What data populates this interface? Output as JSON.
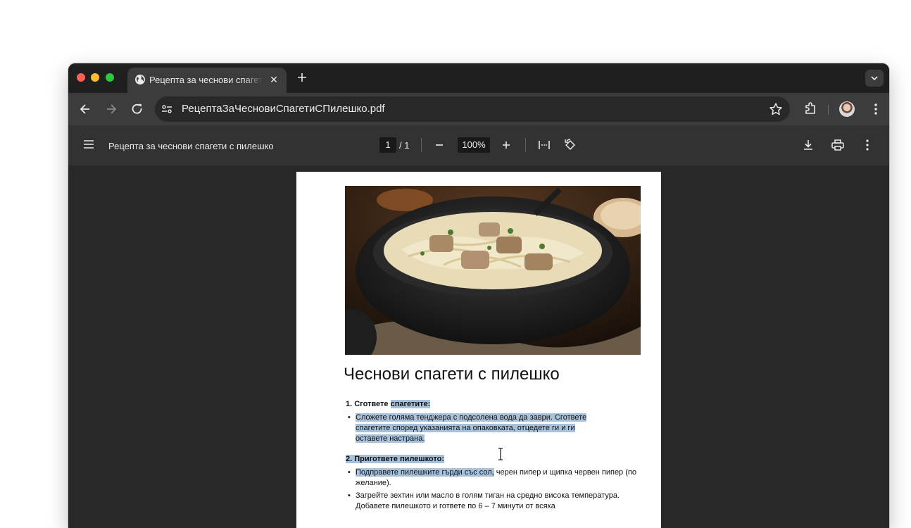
{
  "tab": {
    "title": "Рецепта за чеснови спагети с пилешко",
    "close": "✕"
  },
  "toolbar": {
    "url": "РецептаЗаЧесновиСпагетиСПилешко.pdf"
  },
  "pdf_toolbar": {
    "doc_title": "Рецепта за чеснови спагети с пилешко",
    "page_current": "1",
    "page_total": "/ 1",
    "zoom": "100%"
  },
  "document": {
    "title": "Чеснови спагети с пилешко",
    "step1": {
      "prefix": "1. Сгответе ",
      "highlighted": "спагетите:"
    },
    "step1_bullet": "Сложете голяма тенджера с подсолена вода да заври. Сгответе спагетите според указанията на опаковката, отцедете ги и ги оставете настрана.",
    "step2": "2. Пригответе пилешкото:",
    "step2_bullet1": {
      "highlighted": "Подправете пилешките гърди със сол,",
      "rest": " черен пипер и щипка червен пипер (по желание)."
    },
    "step2_bullet2": "Загрейте зехтин или масло в голям тиган на средно висока температура. Добавете пилешкото и гответе по 6 – 7 минути от всяка",
    "bullet_char": "•"
  },
  "icons": [
    "globe-icon",
    "close-icon",
    "plus-icon",
    "chevron-down-icon",
    "back-icon",
    "forward-icon",
    "reload-icon",
    "site-info-icon",
    "star-icon",
    "extensions-icon",
    "avatar",
    "more-icon",
    "hamburger-icon",
    "zoom-out-icon",
    "zoom-in-icon",
    "fit-page-icon",
    "rotate-icon",
    "download-icon",
    "print-icon",
    "text-cursor-icon"
  ],
  "colors": {
    "highlight": "#a8c2dc",
    "tabstrip": "#1f1f1f",
    "toolbar": "#3c3c3c",
    "pdf_bar": "#323232",
    "viewer_bg": "#282828"
  }
}
